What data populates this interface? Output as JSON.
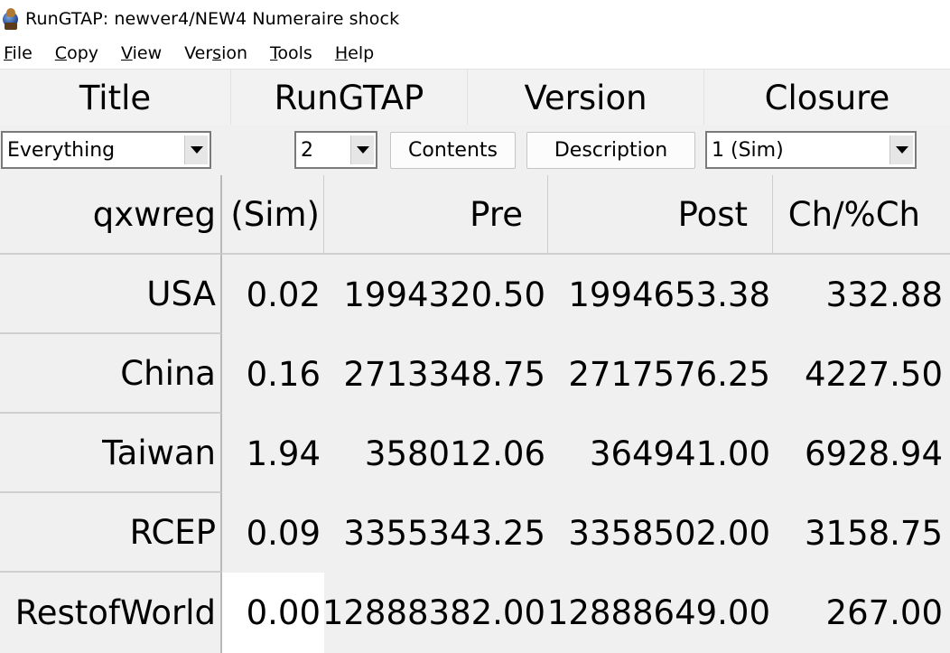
{
  "window": {
    "title": "RunGTAP: newver4/NEW4  Numeraire shock"
  },
  "menu": [
    {
      "underline": "F",
      "rest": "ile"
    },
    {
      "underline": "C",
      "rest": "opy"
    },
    {
      "underline": "V",
      "rest": "iew"
    },
    {
      "pre": "Ver",
      "underline": "s",
      "rest": "ion"
    },
    {
      "underline": "T",
      "rest": "ools"
    },
    {
      "underline": "H",
      "rest": "elp"
    }
  ],
  "header": {
    "title": "Title",
    "rungtap": "RunGTAP",
    "version": "Version",
    "closure": "Closure"
  },
  "controls": {
    "title_select": "Everything",
    "version_select": "2",
    "contents_button": "Contents",
    "description_button": "Description",
    "closure_select": "1 (Sim)"
  },
  "table": {
    "corner": "qxwreg",
    "columns": [
      "(Sim)",
      "Pre",
      "Post",
      "Ch/%Ch"
    ],
    "rows": [
      {
        "label": "USA",
        "values": [
          "0.02",
          "1994320.50",
          "1994653.38",
          "332.88"
        ]
      },
      {
        "label": "China",
        "values": [
          "0.16",
          "2713348.75",
          "2717576.25",
          "4227.50"
        ]
      },
      {
        "label": "Taiwan",
        "values": [
          "1.94",
          "358012.06",
          "364941.00",
          "6928.94"
        ]
      },
      {
        "label": "RCEP",
        "values": [
          "0.09",
          "3355343.25",
          "3358502.00",
          "3158.75"
        ]
      },
      {
        "label": "RestofWorld",
        "values": [
          "0.00",
          "12888382.00",
          "12888649.00",
          "267.00"
        ]
      }
    ],
    "selected_cell": "RestofWorld / (Sim)"
  },
  "icons": {
    "app": "rungtap-globe-icon",
    "dropdown": "chevron-down-icon"
  },
  "colors": {
    "window_bg": "#f0f0f0",
    "titlebar_bg": "#ffffff",
    "selected_cell_bg": "#ffffff"
  }
}
